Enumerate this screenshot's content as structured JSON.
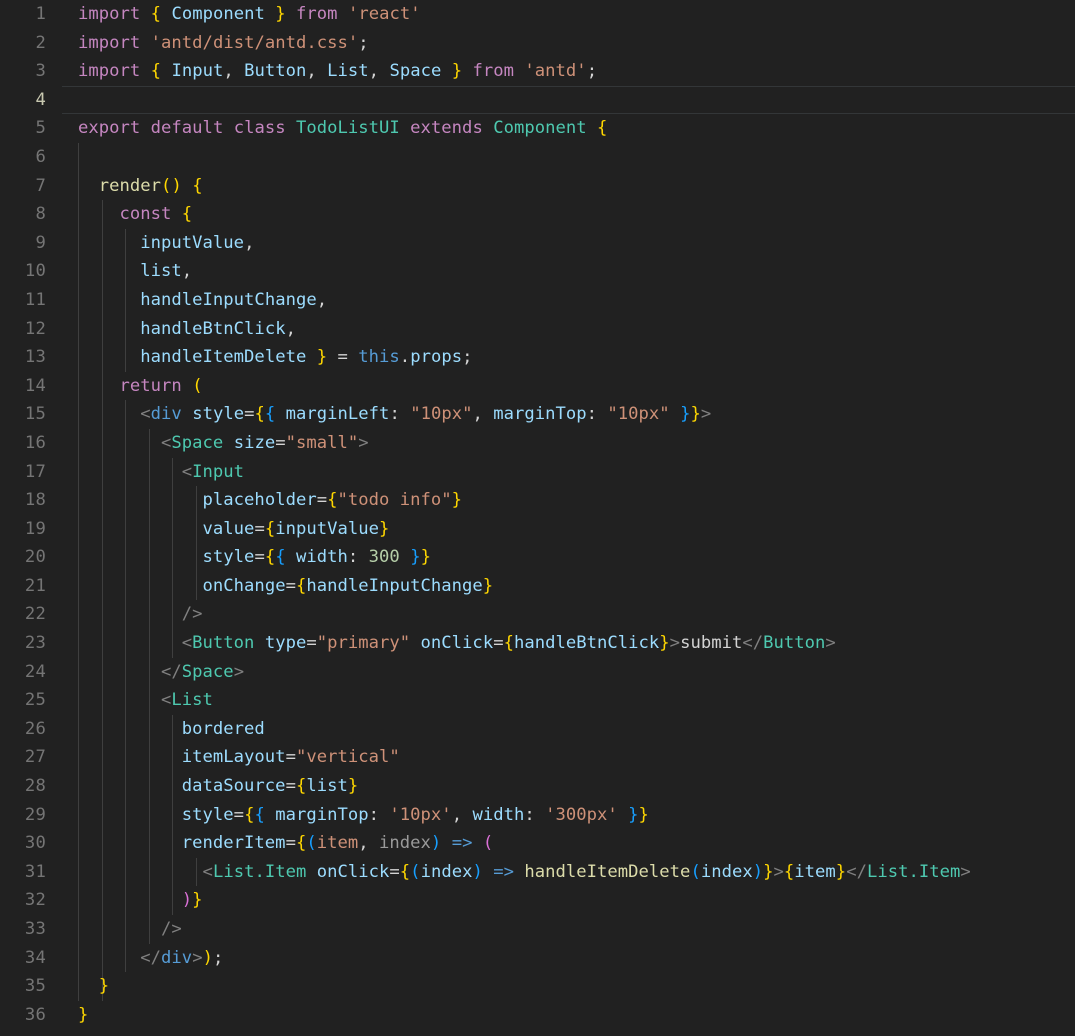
{
  "editor": {
    "language": "jsx",
    "theme": "dark-plus",
    "background_color": "#212121",
    "active_line": 4,
    "line_count": 36,
    "gutter_color": "#757575",
    "active_gutter_color": "#c8c8b0",
    "indent_guide_color": "#3f3f3f",
    "font_size_px": 17,
    "line_height_px": 29
  },
  "code": {
    "full_text": "import { Component } from 'react'\nimport 'antd/dist/antd.css';\nimport { Input, Button, List, Space } from 'antd';\n\nexport default class TodoListUI extends Component {\n\n  render() {\n    const {\n      inputValue,\n      list,\n      handleInputChange,\n      handleBtnClick,\n      handleItemDelete } = this.props;\n    return (\n      <div style={{ marginLeft: \"10px\", marginTop: \"10px\" }}>\n        <Space size=\"small\">\n          <Input\n            placeholder={\"todo info\"}\n            value={inputValue}\n            style={{ width: 300 }}\n            onChange={handleInputChange}\n          />\n          <Button type=\"primary\" onClick={handleBtnClick}>submit</Button>\n        </Space>\n        <List\n          bordered\n          itemLayout=\"vertical\"\n          dataSource={list}\n          style={{ marginTop: '10px', width: '300px' }}\n          renderItem={(item, index) => (\n            <List.Item onClick={(index) => handleItemDelete(index)}>{item}</List.Item>\n          )}\n        />\n      </div>);\n  }\n}"
  },
  "lines": [
    {
      "number": "1",
      "indent": 0,
      "active": false,
      "text": "import { Component } from 'react'"
    },
    {
      "number": "2",
      "indent": 0,
      "active": false,
      "text": "import 'antd/dist/antd.css';"
    },
    {
      "number": "3",
      "indent": 0,
      "active": false,
      "text": "import { Input, Button, List, Space } from 'antd';"
    },
    {
      "number": "4",
      "indent": 0,
      "active": true,
      "text": ""
    },
    {
      "number": "5",
      "indent": 0,
      "active": false,
      "text": "export default class TodoListUI extends Component {"
    },
    {
      "number": "6",
      "indent": 1,
      "active": false,
      "text": ""
    },
    {
      "number": "7",
      "indent": 1,
      "active": false,
      "text": "  render() {"
    },
    {
      "number": "8",
      "indent": 2,
      "active": false,
      "text": "    const {"
    },
    {
      "number": "9",
      "indent": 3,
      "active": false,
      "text": "      inputValue,"
    },
    {
      "number": "10",
      "indent": 3,
      "active": false,
      "text": "      list,"
    },
    {
      "number": "11",
      "indent": 3,
      "active": false,
      "text": "      handleInputChange,"
    },
    {
      "number": "12",
      "indent": 3,
      "active": false,
      "text": "      handleBtnClick,"
    },
    {
      "number": "13",
      "indent": 3,
      "active": false,
      "text": "      handleItemDelete } = this.props;"
    },
    {
      "number": "14",
      "indent": 2,
      "active": false,
      "text": "    return ("
    },
    {
      "number": "15",
      "indent": 3,
      "active": false,
      "text": "      <div style={{ marginLeft: \"10px\", marginTop: \"10px\" }}>"
    },
    {
      "number": "16",
      "indent": 4,
      "active": false,
      "text": "        <Space size=\"small\">"
    },
    {
      "number": "17",
      "indent": 5,
      "active": false,
      "text": "          <Input"
    },
    {
      "number": "18",
      "indent": 6,
      "active": false,
      "text": "            placeholder={\"todo info\"}"
    },
    {
      "number": "19",
      "indent": 6,
      "active": false,
      "text": "            value={inputValue}"
    },
    {
      "number": "20",
      "indent": 6,
      "active": false,
      "text": "            style={{ width: 300 }}"
    },
    {
      "number": "21",
      "indent": 6,
      "active": false,
      "text": "            onChange={handleInputChange}"
    },
    {
      "number": "22",
      "indent": 5,
      "active": false,
      "text": "          />"
    },
    {
      "number": "23",
      "indent": 5,
      "active": false,
      "text": "          <Button type=\"primary\" onClick={handleBtnClick}>submit</Button>"
    },
    {
      "number": "24",
      "indent": 4,
      "active": false,
      "text": "        </Space>"
    },
    {
      "number": "25",
      "indent": 4,
      "active": false,
      "text": "        <List"
    },
    {
      "number": "26",
      "indent": 5,
      "active": false,
      "text": "          bordered"
    },
    {
      "number": "27",
      "indent": 5,
      "active": false,
      "text": "          itemLayout=\"vertical\""
    },
    {
      "number": "28",
      "indent": 5,
      "active": false,
      "text": "          dataSource={list}"
    },
    {
      "number": "29",
      "indent": 5,
      "active": false,
      "text": "          style={{ marginTop: '10px', width: '300px' }}"
    },
    {
      "number": "30",
      "indent": 5,
      "active": false,
      "text": "          renderItem={(item, index) => ("
    },
    {
      "number": "31",
      "indent": 6,
      "active": false,
      "text": "            <List.Item onClick={(index) => handleItemDelete(index)}>{item}</List.Item>"
    },
    {
      "number": "32",
      "indent": 5,
      "active": false,
      "text": "          )}"
    },
    {
      "number": "33",
      "indent": 4,
      "active": false,
      "text": "        />"
    },
    {
      "number": "34",
      "indent": 3,
      "active": false,
      "text": "      </div>);"
    },
    {
      "number": "35",
      "indent": 2,
      "active": false,
      "text": "  }"
    },
    {
      "number": "36",
      "indent": 0,
      "active": false,
      "text": "}"
    }
  ],
  "tokens": {
    "1": [
      [
        "import",
        "t-kw"
      ],
      [
        " ",
        "t-txt"
      ],
      [
        "{",
        "t-brace"
      ],
      [
        " ",
        "t-txt"
      ],
      [
        "Component",
        "t-id"
      ],
      [
        " ",
        "t-txt"
      ],
      [
        "}",
        "t-brace"
      ],
      [
        " ",
        "t-txt"
      ],
      [
        "from",
        "t-kw"
      ],
      [
        " ",
        "t-txt"
      ],
      [
        "'react'",
        "t-str"
      ]
    ],
    "2": [
      [
        "import",
        "t-kw"
      ],
      [
        " ",
        "t-txt"
      ],
      [
        "'antd/dist/antd.css'",
        "t-str"
      ],
      [
        ";",
        "t-punc"
      ]
    ],
    "3": [
      [
        "import",
        "t-kw"
      ],
      [
        " ",
        "t-txt"
      ],
      [
        "{",
        "t-brace"
      ],
      [
        " ",
        "t-txt"
      ],
      [
        "Input",
        "t-id"
      ],
      [
        ", ",
        "t-punc"
      ],
      [
        "Button",
        "t-id"
      ],
      [
        ", ",
        "t-punc"
      ],
      [
        "List",
        "t-id"
      ],
      [
        ", ",
        "t-punc"
      ],
      [
        "Space",
        "t-id"
      ],
      [
        " ",
        "t-txt"
      ],
      [
        "}",
        "t-brace"
      ],
      [
        " ",
        "t-txt"
      ],
      [
        "from",
        "t-kw"
      ],
      [
        " ",
        "t-txt"
      ],
      [
        "'antd'",
        "t-str"
      ],
      [
        ";",
        "t-punc"
      ]
    ],
    "4": [],
    "5": [
      [
        "export",
        "t-kw"
      ],
      [
        " ",
        "t-txt"
      ],
      [
        "default",
        "t-kw"
      ],
      [
        " ",
        "t-txt"
      ],
      [
        "class",
        "t-kw"
      ],
      [
        " ",
        "t-txt"
      ],
      [
        "TodoListUI",
        "t-type"
      ],
      [
        " ",
        "t-txt"
      ],
      [
        "extends",
        "t-kw"
      ],
      [
        " ",
        "t-txt"
      ],
      [
        "Component",
        "t-type"
      ],
      [
        " ",
        "t-txt"
      ],
      [
        "{",
        "t-brace"
      ]
    ],
    "6": [],
    "7": [
      [
        "  ",
        "t-txt"
      ],
      [
        "render",
        "t-fn"
      ],
      [
        "(",
        "t-brace"
      ],
      [
        ")",
        "t-brace"
      ],
      [
        " ",
        "t-txt"
      ],
      [
        "{",
        "t-brace"
      ]
    ],
    "8": [
      [
        "    ",
        "t-txt"
      ],
      [
        "const",
        "t-kw"
      ],
      [
        " ",
        "t-txt"
      ],
      [
        "{",
        "t-brace"
      ]
    ],
    "9": [
      [
        "      ",
        "t-txt"
      ],
      [
        "inputValue",
        "t-id"
      ],
      [
        ",",
        "t-punc"
      ]
    ],
    "10": [
      [
        "      ",
        "t-txt"
      ],
      [
        "list",
        "t-id"
      ],
      [
        ",",
        "t-punc"
      ]
    ],
    "11": [
      [
        "      ",
        "t-txt"
      ],
      [
        "handleInputChange",
        "t-id"
      ],
      [
        ",",
        "t-punc"
      ]
    ],
    "12": [
      [
        "      ",
        "t-txt"
      ],
      [
        "handleBtnClick",
        "t-id"
      ],
      [
        ",",
        "t-punc"
      ]
    ],
    "13": [
      [
        "      ",
        "t-txt"
      ],
      [
        "handleItemDelete",
        "t-id"
      ],
      [
        " ",
        "t-txt"
      ],
      [
        "}",
        "t-brace"
      ],
      [
        " ",
        "t-txt"
      ],
      [
        "=",
        "t-punc"
      ],
      [
        " ",
        "t-txt"
      ],
      [
        "this",
        "t-this"
      ],
      [
        ".",
        "t-punc"
      ],
      [
        "props",
        "t-prop"
      ],
      [
        ";",
        "t-punc"
      ]
    ],
    "14": [
      [
        "    ",
        "t-txt"
      ],
      [
        "return",
        "t-kw"
      ],
      [
        " ",
        "t-txt"
      ],
      [
        "(",
        "t-brace"
      ]
    ],
    "15": [
      [
        "      ",
        "t-txt"
      ],
      [
        "<",
        "t-angle"
      ],
      [
        "div",
        "t-tag"
      ],
      [
        " ",
        "t-txt"
      ],
      [
        "style",
        "t-id"
      ],
      [
        "=",
        "t-punc"
      ],
      [
        "{",
        "t-brace"
      ],
      [
        "{",
        "t-brace3"
      ],
      [
        " ",
        "t-txt"
      ],
      [
        "marginLeft",
        "t-id"
      ],
      [
        ": ",
        "t-punc"
      ],
      [
        "\"10px\"",
        "t-str"
      ],
      [
        ", ",
        "t-punc"
      ],
      [
        "marginTop",
        "t-id"
      ],
      [
        ": ",
        "t-punc"
      ],
      [
        "\"10px\"",
        "t-str"
      ],
      [
        " ",
        "t-txt"
      ],
      [
        "}",
        "t-brace3"
      ],
      [
        "}",
        "t-brace"
      ],
      [
        ">",
        "t-angle"
      ]
    ],
    "16": [
      [
        "        ",
        "t-txt"
      ],
      [
        "<",
        "t-angle"
      ],
      [
        "Space",
        "t-type"
      ],
      [
        " ",
        "t-txt"
      ],
      [
        "size",
        "t-id"
      ],
      [
        "=",
        "t-punc"
      ],
      [
        "\"small\"",
        "t-str"
      ],
      [
        ">",
        "t-angle"
      ]
    ],
    "17": [
      [
        "          ",
        "t-txt"
      ],
      [
        "<",
        "t-angle"
      ],
      [
        "Input",
        "t-type"
      ]
    ],
    "18": [
      [
        "            ",
        "t-txt"
      ],
      [
        "placeholder",
        "t-id"
      ],
      [
        "=",
        "t-punc"
      ],
      [
        "{",
        "t-brace"
      ],
      [
        "\"todo info\"",
        "t-str"
      ],
      [
        "}",
        "t-brace"
      ]
    ],
    "19": [
      [
        "            ",
        "t-txt"
      ],
      [
        "value",
        "t-id"
      ],
      [
        "=",
        "t-punc"
      ],
      [
        "{",
        "t-brace"
      ],
      [
        "inputValue",
        "t-id"
      ],
      [
        "}",
        "t-brace"
      ]
    ],
    "20": [
      [
        "            ",
        "t-txt"
      ],
      [
        "style",
        "t-id"
      ],
      [
        "=",
        "t-punc"
      ],
      [
        "{",
        "t-brace"
      ],
      [
        "{",
        "t-brace3"
      ],
      [
        " ",
        "t-txt"
      ],
      [
        "width",
        "t-id"
      ],
      [
        ": ",
        "t-punc"
      ],
      [
        "300",
        "t-num"
      ],
      [
        " ",
        "t-txt"
      ],
      [
        "}",
        "t-brace3"
      ],
      [
        "}",
        "t-brace"
      ]
    ],
    "21": [
      [
        "            ",
        "t-txt"
      ],
      [
        "onChange",
        "t-id"
      ],
      [
        "=",
        "t-punc"
      ],
      [
        "{",
        "t-brace"
      ],
      [
        "handleInputChange",
        "t-id"
      ],
      [
        "}",
        "t-brace"
      ]
    ],
    "22": [
      [
        "          ",
        "t-txt"
      ],
      [
        "/>",
        "t-angle"
      ]
    ],
    "23": [
      [
        "          ",
        "t-txt"
      ],
      [
        "<",
        "t-angle"
      ],
      [
        "Button",
        "t-type"
      ],
      [
        " ",
        "t-txt"
      ],
      [
        "type",
        "t-id"
      ],
      [
        "=",
        "t-punc"
      ],
      [
        "\"primary\"",
        "t-str"
      ],
      [
        " ",
        "t-txt"
      ],
      [
        "onClick",
        "t-id"
      ],
      [
        "=",
        "t-punc"
      ],
      [
        "{",
        "t-brace"
      ],
      [
        "handleBtnClick",
        "t-id"
      ],
      [
        "}",
        "t-brace"
      ],
      [
        ">",
        "t-angle"
      ],
      [
        "submit",
        "t-txt"
      ],
      [
        "</",
        "t-angle"
      ],
      [
        "Button",
        "t-type"
      ],
      [
        ">",
        "t-angle"
      ]
    ],
    "24": [
      [
        "        ",
        "t-txt"
      ],
      [
        "</",
        "t-angle"
      ],
      [
        "Space",
        "t-type"
      ],
      [
        ">",
        "t-angle"
      ]
    ],
    "25": [
      [
        "        ",
        "t-txt"
      ],
      [
        "<",
        "t-angle"
      ],
      [
        "List",
        "t-type"
      ]
    ],
    "26": [
      [
        "          ",
        "t-txt"
      ],
      [
        "bordered",
        "t-id"
      ]
    ],
    "27": [
      [
        "          ",
        "t-txt"
      ],
      [
        "itemLayout",
        "t-id"
      ],
      [
        "=",
        "t-punc"
      ],
      [
        "\"vertical\"",
        "t-str"
      ]
    ],
    "28": [
      [
        "          ",
        "t-txt"
      ],
      [
        "dataSource",
        "t-id"
      ],
      [
        "=",
        "t-punc"
      ],
      [
        "{",
        "t-brace"
      ],
      [
        "list",
        "t-id"
      ],
      [
        "}",
        "t-brace"
      ]
    ],
    "29": [
      [
        "          ",
        "t-txt"
      ],
      [
        "style",
        "t-id"
      ],
      [
        "=",
        "t-punc"
      ],
      [
        "{",
        "t-brace"
      ],
      [
        "{",
        "t-brace3"
      ],
      [
        " ",
        "t-txt"
      ],
      [
        "marginTop",
        "t-id"
      ],
      [
        ": ",
        "t-punc"
      ],
      [
        "'10px'",
        "t-str"
      ],
      [
        ", ",
        "t-punc"
      ],
      [
        "width",
        "t-id"
      ],
      [
        ": ",
        "t-punc"
      ],
      [
        "'300px'",
        "t-str"
      ],
      [
        " ",
        "t-txt"
      ],
      [
        "}",
        "t-brace3"
      ],
      [
        "}",
        "t-brace"
      ]
    ],
    "30": [
      [
        "          ",
        "t-txt"
      ],
      [
        "renderItem",
        "t-id"
      ],
      [
        "=",
        "t-punc"
      ],
      [
        "{",
        "t-brace"
      ],
      [
        "(",
        "t-brace3"
      ],
      [
        "item",
        "t-str"
      ],
      [
        ", ",
        "t-punc"
      ],
      [
        "index",
        "t-dim"
      ],
      [
        ")",
        "t-brace3"
      ],
      [
        " ",
        "t-txt"
      ],
      [
        "=>",
        "t-arrow"
      ],
      [
        " ",
        "t-txt"
      ],
      [
        "(",
        "t-brace2"
      ]
    ],
    "31": [
      [
        "            ",
        "t-txt"
      ],
      [
        "<",
        "t-angle"
      ],
      [
        "List.Item",
        "t-type"
      ],
      [
        " ",
        "t-txt"
      ],
      [
        "onClick",
        "t-id"
      ],
      [
        "=",
        "t-punc"
      ],
      [
        "{",
        "t-brace"
      ],
      [
        "(",
        "t-brace3"
      ],
      [
        "index",
        "t-id"
      ],
      [
        ")",
        "t-brace3"
      ],
      [
        " ",
        "t-txt"
      ],
      [
        "=>",
        "t-arrow"
      ],
      [
        " ",
        "t-txt"
      ],
      [
        "handleItemDelete",
        "t-fn"
      ],
      [
        "(",
        "t-brace3"
      ],
      [
        "index",
        "t-id"
      ],
      [
        ")",
        "t-brace3"
      ],
      [
        "}",
        "t-brace"
      ],
      [
        ">",
        "t-angle"
      ],
      [
        "{",
        "t-brace"
      ],
      [
        "item",
        "t-id"
      ],
      [
        "}",
        "t-brace"
      ],
      [
        "</",
        "t-angle"
      ],
      [
        "List.Item",
        "t-type"
      ],
      [
        ">",
        "t-angle"
      ]
    ],
    "32": [
      [
        "          ",
        "t-txt"
      ],
      [
        ")",
        "t-brace2"
      ],
      [
        "}",
        "t-brace"
      ]
    ],
    "33": [
      [
        "        ",
        "t-txt"
      ],
      [
        "/>",
        "t-angle"
      ]
    ],
    "34": [
      [
        "      ",
        "t-txt"
      ],
      [
        "</",
        "t-angle"
      ],
      [
        "div",
        "t-tag"
      ],
      [
        ">",
        "t-angle"
      ],
      [
        ")",
        "t-brace"
      ],
      [
        ";",
        "t-punc"
      ]
    ],
    "35": [
      [
        "  ",
        "t-txt"
      ],
      [
        "}",
        "t-brace"
      ]
    ],
    "36": [
      [
        "}",
        "t-brace"
      ]
    ]
  }
}
